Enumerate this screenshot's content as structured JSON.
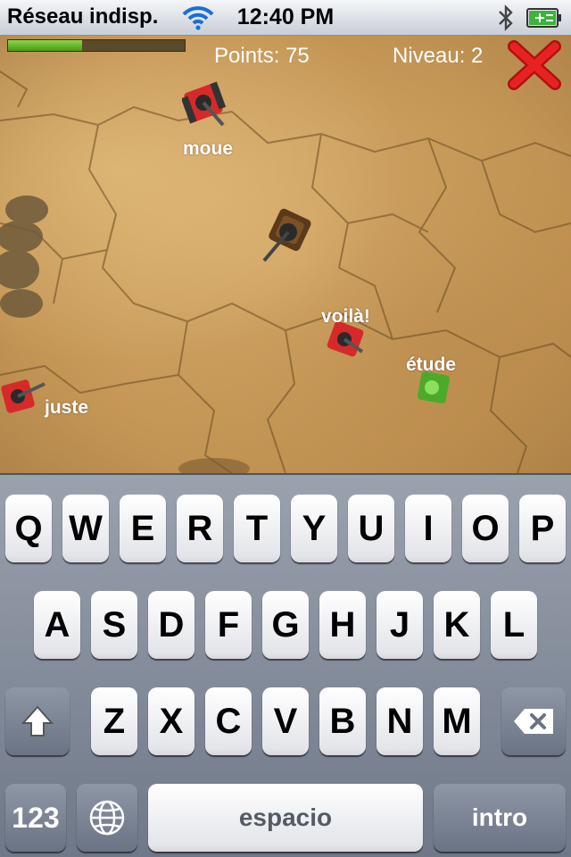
{
  "status_bar": {
    "carrier": "Réseau indisp.",
    "time": "12:40 PM",
    "wifi_icon": "wifi-icon",
    "bluetooth_icon": "bluetooth-icon",
    "battery_icon": "battery-charging-icon"
  },
  "hud": {
    "points": "Points: 75",
    "level": "Niveau: 2",
    "health_fraction": 0.42,
    "close_icon": "close-x-icon"
  },
  "enemies": [
    {
      "word": "moue",
      "color": "#d62a2a"
    },
    {
      "word": "voilà!",
      "color": "#d62a2a"
    },
    {
      "word": "étude",
      "color": "#4caa2a"
    },
    {
      "word": "juste",
      "color": "#d62a2a"
    }
  ],
  "player": {
    "icon": "player-tank-icon"
  },
  "keyboard": {
    "row1": [
      "Q",
      "W",
      "E",
      "R",
      "T",
      "Y",
      "U",
      "I",
      "O",
      "P"
    ],
    "row2": [
      "A",
      "S",
      "D",
      "F",
      "G",
      "H",
      "J",
      "K",
      "L"
    ],
    "row3": [
      "Z",
      "X",
      "C",
      "V",
      "B",
      "N",
      "M"
    ],
    "shift_icon": "shift-arrow-icon",
    "delete_icon": "backspace-icon",
    "numbers_label": "123",
    "globe_icon": "globe-icon",
    "space_label": "espacio",
    "return_label": "intro"
  }
}
